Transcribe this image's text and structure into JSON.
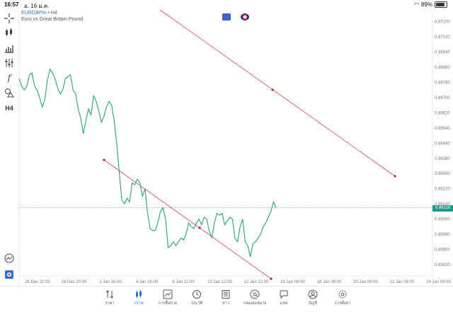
{
  "status_bar": {
    "time": "16:57",
    "date": "อ. 16 ม.ค.",
    "battery": "89%",
    "battery_level": 0.89
  },
  "symbol": {
    "name": "EURGBPm",
    "timeframe": "H4",
    "separator": "•",
    "description": "Euro vs Great Britain Pound"
  },
  "toolbar": {
    "icons": [
      "crosshair-icon",
      "candles-icon",
      "bar-chart-icon",
      "indicators-icon",
      "function-icon",
      "objects-icon"
    ],
    "timeframe_label": "H4"
  },
  "chart_data": {
    "type": "line",
    "series": [
      {
        "values": [
          0.868,
          0.8676,
          0.8674,
          0.8676,
          0.8682,
          0.8683,
          0.8676,
          0.8674,
          0.867,
          0.8665,
          0.8669,
          0.8679,
          0.8685,
          0.8683,
          0.868,
          0.8675,
          0.8672,
          0.8674,
          0.868,
          0.8681,
          0.8682,
          0.8674,
          0.8672,
          0.8664,
          0.8659,
          0.8651,
          0.8658,
          0.8664,
          0.8661,
          0.8671,
          0.8668,
          0.8663,
          0.8657,
          0.866,
          0.8665,
          0.8668,
          0.8666,
          0.8658,
          0.8646,
          0.863,
          0.8616,
          0.8614,
          0.8617,
          0.8615,
          0.8625,
          0.8624,
          0.8627,
          0.8625,
          0.8618,
          0.8622,
          0.8609,
          0.8601,
          0.86,
          0.86,
          0.8604,
          0.861,
          0.8612,
          0.8606,
          0.8591,
          0.8592,
          0.8594,
          0.8592,
          0.8594,
          0.8596,
          0.8595,
          0.8598,
          0.8604,
          0.8602,
          0.8601,
          0.8604,
          0.8606,
          0.8603,
          0.8607,
          0.8606,
          0.86,
          0.8596,
          0.8604,
          0.8609,
          0.8608,
          0.8609,
          0.8603,
          0.8605,
          0.8607,
          0.8606,
          0.8596,
          0.8594,
          0.8602,
          0.8606,
          0.8594,
          0.8592,
          0.8586,
          0.8593,
          0.8594,
          0.8596,
          0.8598,
          0.8602,
          0.8604,
          0.8607,
          0.861,
          0.8615,
          0.8612
        ]
      }
    ],
    "x_labels": [
      "26 Dec 20:00",
      "28 Dec 20:00",
      "2 Jan 16:00",
      "4 Jan 16:00",
      "8 Jan 12:00",
      "10 Jan 12:00",
      "12 Jan 12:00",
      "16 Jan 08:00",
      "18 Jan 08:00",
      "20 Jan 08:00",
      "22 Jan 08:00",
      "24 Jan 08:00"
    ],
    "y_ticks": [
      0.871,
      0.8702,
      0.8694,
      0.8686,
      0.8678,
      0.867,
      0.8662,
      0.8654,
      0.8646,
      0.8638,
      0.863,
      0.8622,
      0.8614,
      0.8606,
      0.8598,
      0.859,
      0.8582
    ],
    "ylim": [
      0.8576,
      0.8714
    ],
    "current_price": "0.86119",
    "current_price_value": 0.86119,
    "trendlines": [
      {
        "from": [
          0.0,
          0.8716
        ],
        "to": [
          1.0,
          0.8628
        ],
        "color": "#d44",
        "midpoint": 0.8675
      },
      {
        "from": [
          0.0,
          0.8638
        ],
        "to": [
          1.0,
          0.8576
        ],
        "color": "#d44",
        "midpoint": 0.8603
      }
    ],
    "grid": false
  },
  "nav": [
    {
      "label": "ราคา",
      "icon": "quotes-icon"
    },
    {
      "label": "กราฟ",
      "icon": "chart-icon",
      "active": true
    },
    {
      "label": "การซื้อขาย",
      "icon": "trade-icon"
    },
    {
      "label": "ประวัติ",
      "icon": "history-icon"
    },
    {
      "label": "ข่าว",
      "icon": "news-icon"
    },
    {
      "label": "กล่องจดหมาย",
      "icon": "mailbox-icon"
    },
    {
      "label": "แชท",
      "icon": "chat-icon"
    },
    {
      "label": "บัญชี",
      "icon": "account-icon"
    },
    {
      "label": "การตั้งค่า",
      "icon": "settings-icon"
    }
  ],
  "colors": {
    "line": "#2aa27b",
    "trend": "#d44444",
    "accent": "#2f6fd6",
    "price_tag": "#1f9a8a"
  }
}
